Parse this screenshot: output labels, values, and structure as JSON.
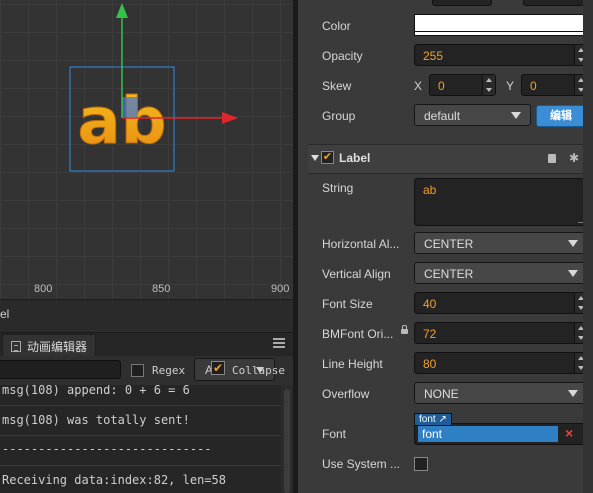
{
  "scene": {
    "label_text": "ab",
    "ruler": [
      "800",
      "850",
      "900"
    ],
    "panel_title_fragment": "el"
  },
  "console": {
    "tab_label": "动画编辑器",
    "filter_placeholder": "",
    "regex_label": "Regex",
    "level_value": "A",
    "collapse_label": "Collapse",
    "lines": [
      "msg(108) append: 0 + 6 = 6",
      "msg(108) was totally sent!",
      "-----------------------------",
      "Receiving data:index:82, len=58"
    ]
  },
  "inspector": {
    "color_label": "Color",
    "color_value": "#ffffff",
    "opacity_label": "Opacity",
    "opacity_value": "255",
    "skew_label": "Skew",
    "skew_x_label": "X",
    "skew_x": "0",
    "skew_y_label": "Y",
    "skew_y": "0",
    "group_label": "Group",
    "group_value": "default",
    "group_edit": "编辑",
    "component_title": "Label",
    "string_label": "String",
    "string_value": "ab",
    "halign_label": "Horizontal Al...",
    "halign_value": "CENTER",
    "valign_label": "Vertical Align",
    "valign_value": "CENTER",
    "font_size_label": "Font Size",
    "font_size_value": "40",
    "bmfont_label": "BMFont Ori...",
    "bmfont_value": "72",
    "line_height_label": "Line Height",
    "line_height_value": "80",
    "overflow_label": "Overflow",
    "overflow_value": "NONE",
    "font_label": "Font",
    "font_tag": "font",
    "font_asset": "font",
    "use_system_label": "Use System ..."
  },
  "colors": {
    "accent": "#f0a030",
    "asset_blue": "#2f7fc5",
    "edit_button": "#3b8ed6",
    "gizmo_x": "#e0272d",
    "gizmo_y": "#35c24a",
    "label_fill": "#f2a516"
  }
}
